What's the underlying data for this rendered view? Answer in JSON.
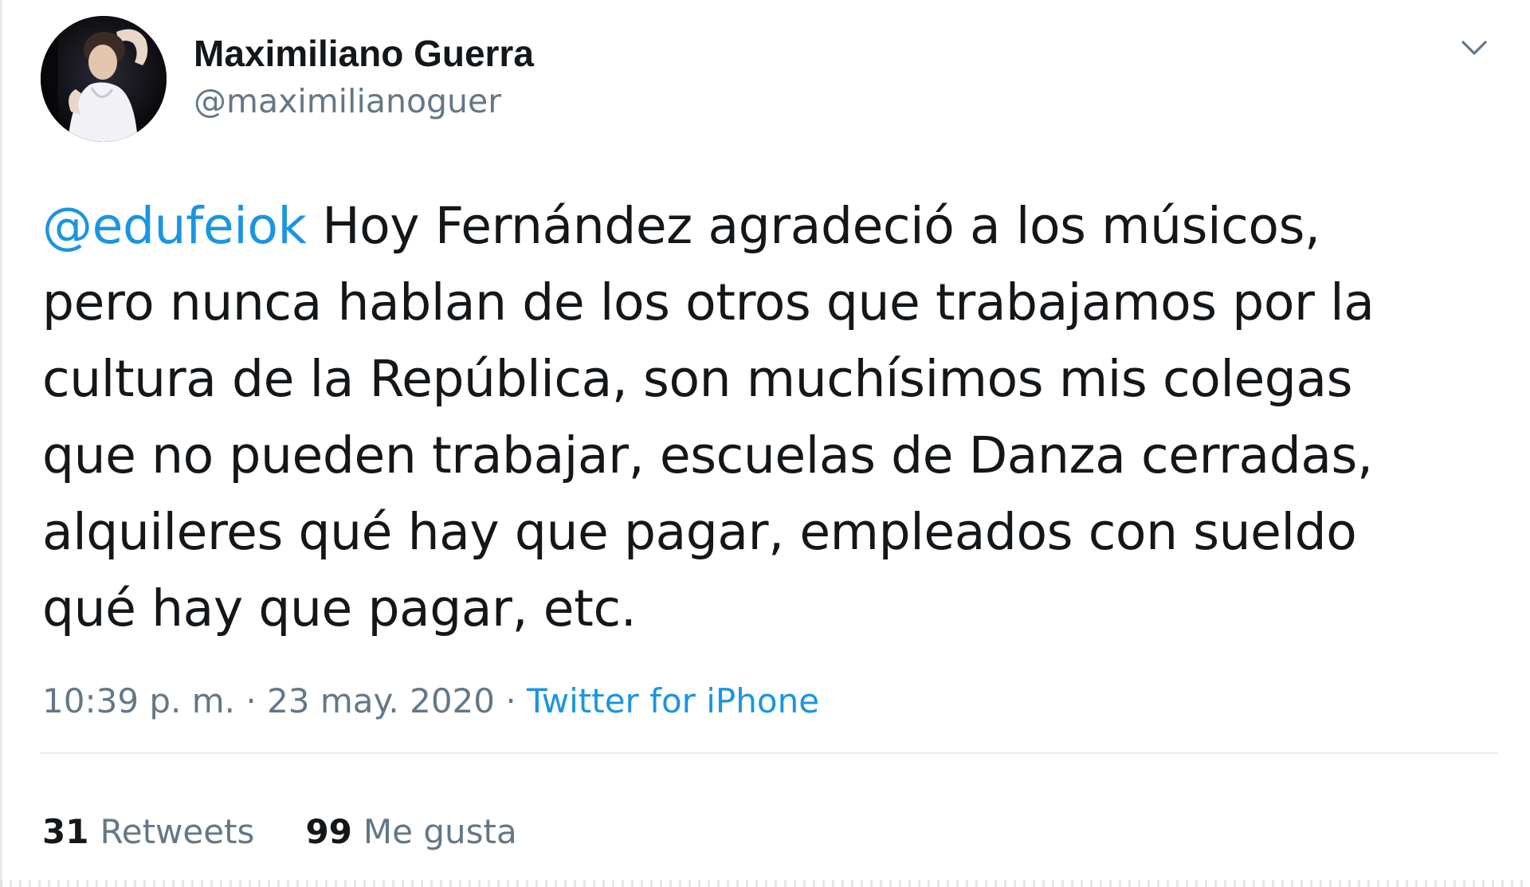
{
  "author": {
    "display_name": "Maximiliano Guerra",
    "handle": "@maximilianoguer"
  },
  "tweet": {
    "mention": "@edufeiok",
    "lines": [
      " Hoy Fernández agradeció a los músicos,",
      "pero nunca hablan de los otros que trabajamos por la",
      "cultura de la República, son muchísimos mis colegas",
      "que no pueden trabajar, escuelas de Danza cerradas,",
      "alquileres qué hay que pagar, empleados con sueldo",
      "qué hay que pagar, etc."
    ]
  },
  "meta": {
    "time": "10:39 p. m.",
    "separator": " · ",
    "date": "23 may. 2020",
    "source": "Twitter for iPhone"
  },
  "stats": {
    "retweets_count": "31",
    "retweets_label": "Retweets",
    "likes_count": "99",
    "likes_label": "Me gusta"
  },
  "colors": {
    "link": "#1b95e0",
    "secondary_text": "#657786",
    "primary_text": "#14171a",
    "divider": "#e6ecf0"
  },
  "icons": {
    "menu": "chevron-down-icon",
    "avatar": "avatar"
  }
}
